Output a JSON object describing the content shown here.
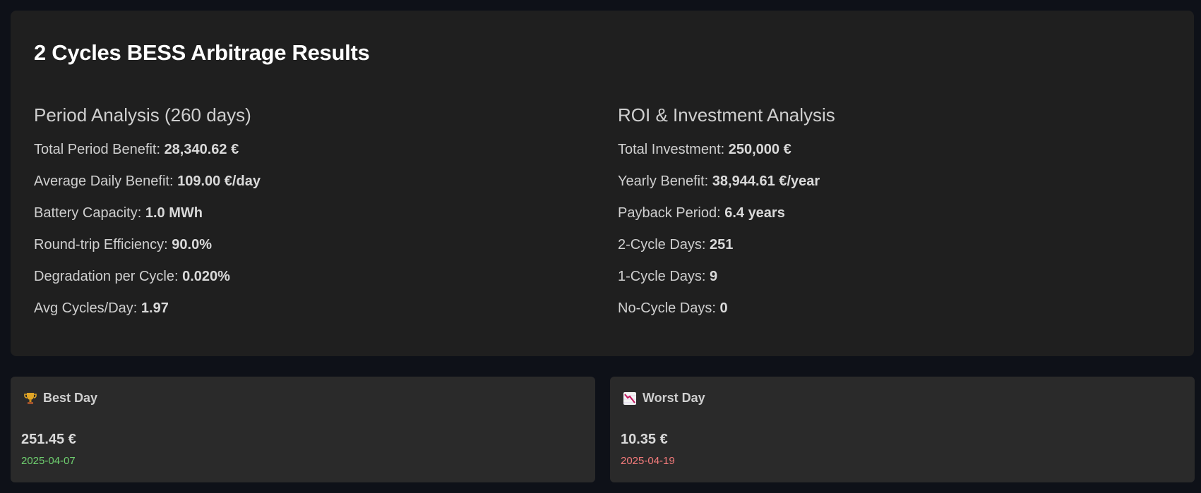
{
  "results": {
    "title": "2 Cycles BESS Arbitrage Results",
    "period": {
      "heading": "Period Analysis (260 days)",
      "stats": [
        {
          "label": "Total Period Benefit: ",
          "value": "28,340.62 €"
        },
        {
          "label": "Average Daily Benefit: ",
          "value": "109.00 €/day"
        },
        {
          "label": "Battery Capacity: ",
          "value": "1.0 MWh"
        },
        {
          "label": "Round-trip Efficiency: ",
          "value": "90.0%"
        },
        {
          "label": "Degradation per Cycle: ",
          "value": "0.020%"
        },
        {
          "label": "Avg Cycles/Day: ",
          "value": "1.97"
        }
      ]
    },
    "roi": {
      "heading": "ROI & Investment Analysis",
      "stats": [
        {
          "label": "Total Investment: ",
          "value": "250,000 €"
        },
        {
          "label": "Yearly Benefit: ",
          "value": "38,944.61 €/year"
        },
        {
          "label": "Payback Period: ",
          "value": "6.4 years"
        },
        {
          "label": "2-Cycle Days: ",
          "value": "251"
        },
        {
          "label": "1-Cycle Days: ",
          "value": "9"
        },
        {
          "label": "No-Cycle Days: ",
          "value": "0"
        }
      ]
    }
  },
  "best_day": {
    "icon": "trophy-icon",
    "label": "Best Day",
    "value": "251.45 €",
    "date": "2025-04-07",
    "date_color": "#6fcf6f"
  },
  "worst_day": {
    "icon": "chart-decreasing-icon",
    "label": "Worst Day",
    "value": "10.35 €",
    "date": "2025-04-19",
    "date_color": "#f27a7a"
  }
}
